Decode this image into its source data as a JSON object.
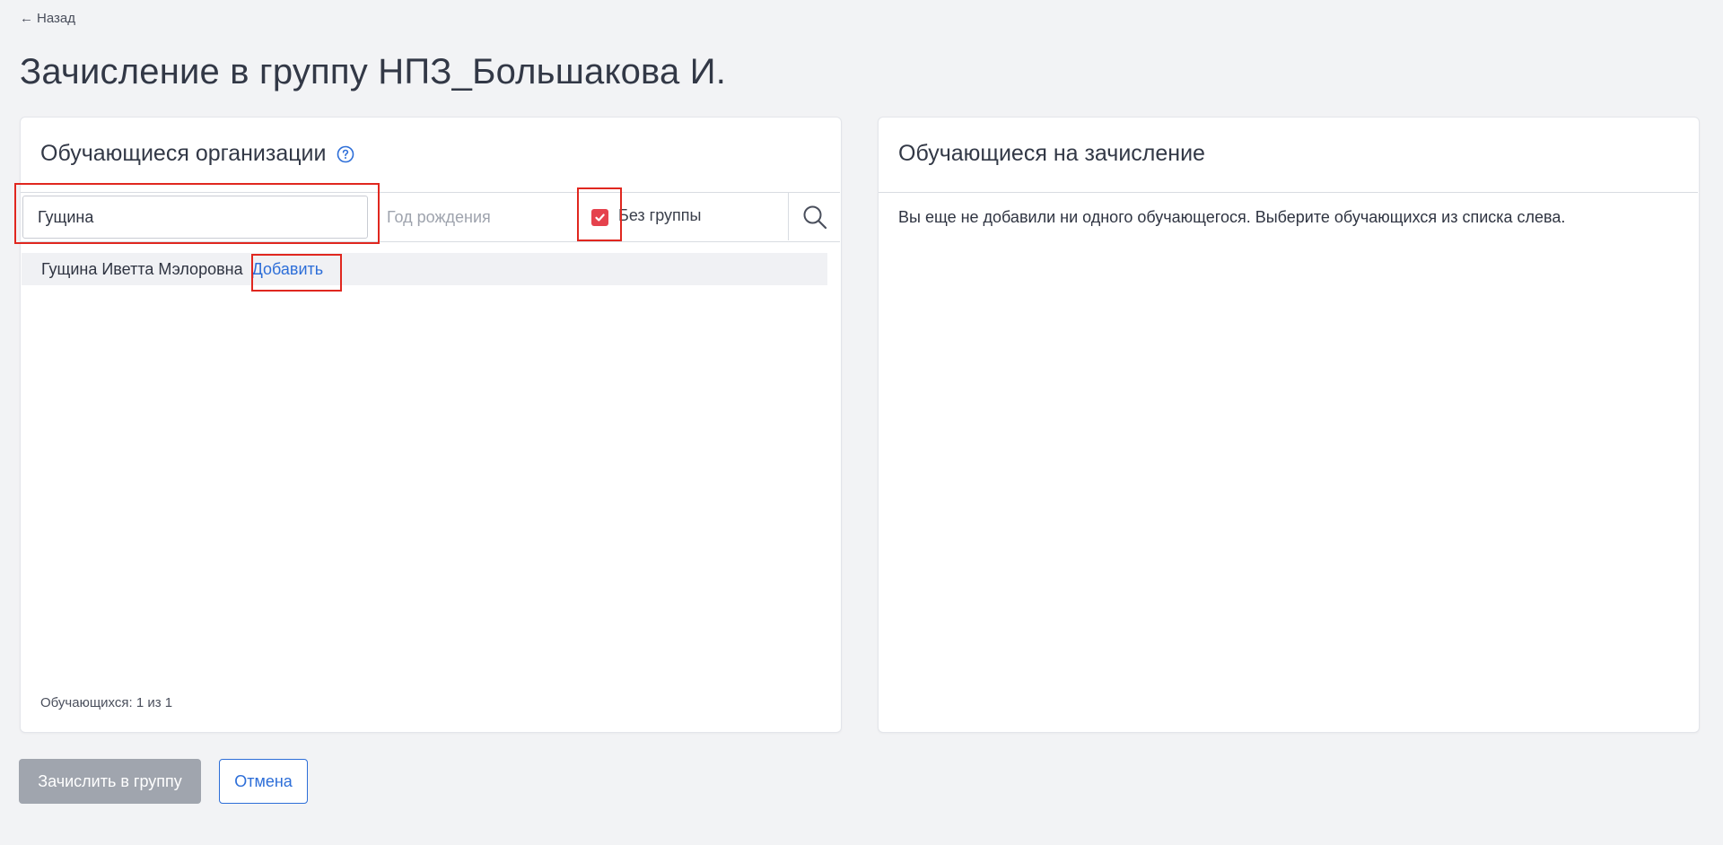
{
  "nav": {
    "back_label": "Назад"
  },
  "page": {
    "title": "Зачисление в группу НПЗ_Большакова И."
  },
  "left_panel": {
    "title": "Обучающиеся организации",
    "filters": {
      "name_value": "Гущина",
      "birth_year_placeholder": "Год рождения",
      "no_group_label": "Без группы",
      "no_group_checked": true
    },
    "results": [
      {
        "name": "Гущина Иветта Мэлоровна",
        "action_label": "Добавить"
      }
    ],
    "count_text": "Обучающихся: 1 из 1"
  },
  "right_panel": {
    "title": "Обучающиеся на зачисление",
    "empty_text": "Вы еще не добавили ни одного обучающегося. Выберите обучающихся из списка слева."
  },
  "footer": {
    "submit_label": "Зачислить в группу",
    "cancel_label": "Отмена"
  },
  "colors": {
    "accent": "#2d6ed8",
    "checkbox": "#e5424d",
    "highlight": "#e0271f",
    "disabled_button": "#a0a5ae",
    "background": "#f2f3f5"
  },
  "icons": {
    "back": "arrow-left-icon",
    "help": "question-circle-icon",
    "checkbox": "checkmark-icon",
    "search": "search-icon"
  }
}
